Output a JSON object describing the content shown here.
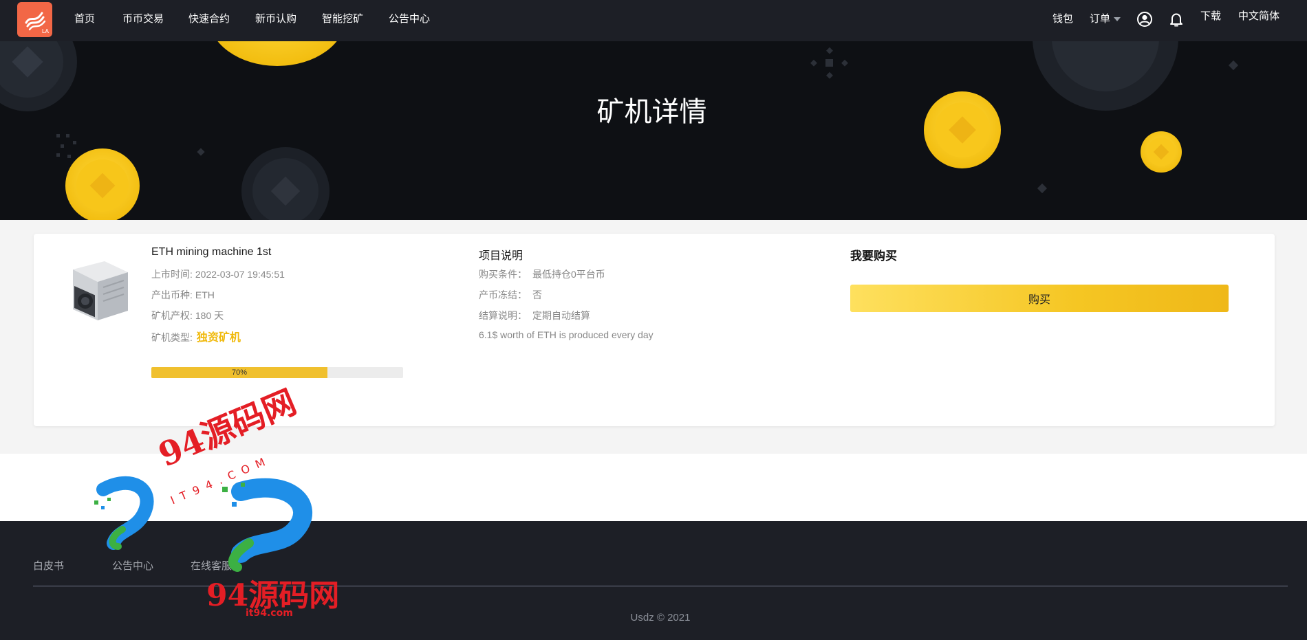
{
  "brand": {
    "logo_text": "LA",
    "logo_color": "#f26746"
  },
  "nav": {
    "items": [
      {
        "label": "首页"
      },
      {
        "label": "币币交易"
      },
      {
        "label": "快速合约"
      },
      {
        "label": "新币认购"
      },
      {
        "label": "智能挖矿"
      },
      {
        "label": "公告中心"
      }
    ],
    "wallet": "钱包",
    "orders": "订单",
    "download": "下载",
    "language": "中文简体",
    "icons": [
      "user-icon",
      "bell-icon",
      "chevron-down-icon"
    ]
  },
  "hero": {
    "title": "矿机详情"
  },
  "product": {
    "name": "ETH mining machine 1st",
    "listing_time_label": "上市时间:",
    "listing_time": "2022-03-07 19:45:51",
    "currency_label": "产出币种:",
    "currency": "ETH",
    "term_label": "矿机产权:",
    "term": "180 天",
    "type_label": "矿机类型:",
    "type": "独资矿机",
    "progress": 0.7,
    "progress_text": "70%"
  },
  "description": {
    "title": "项目说明",
    "condition_label": "购买条件：",
    "condition": "最低持仓0平台币",
    "freeze_label": "产币冻结：",
    "freeze": "否",
    "settle_label": "结算说明：",
    "settle": "定期自动结算",
    "note": "6.1$ worth of ETH is produced every day"
  },
  "purchase": {
    "title": "我要购买",
    "button": "购买"
  },
  "footer": {
    "links": [
      "白皮书",
      "公告中心",
      "在线客服"
    ],
    "copyright": "Usdz © 2021"
  },
  "watermark": {
    "text": "94源码网",
    "sub_a": "IT94.COM",
    "sub_b": "it94.com"
  },
  "colors": {
    "accent": "#f0b90b",
    "header_bg": "#1d1f26",
    "hero_bg": "#0e1014",
    "coin": "#f5c71a",
    "progress": "#f0c02e"
  }
}
